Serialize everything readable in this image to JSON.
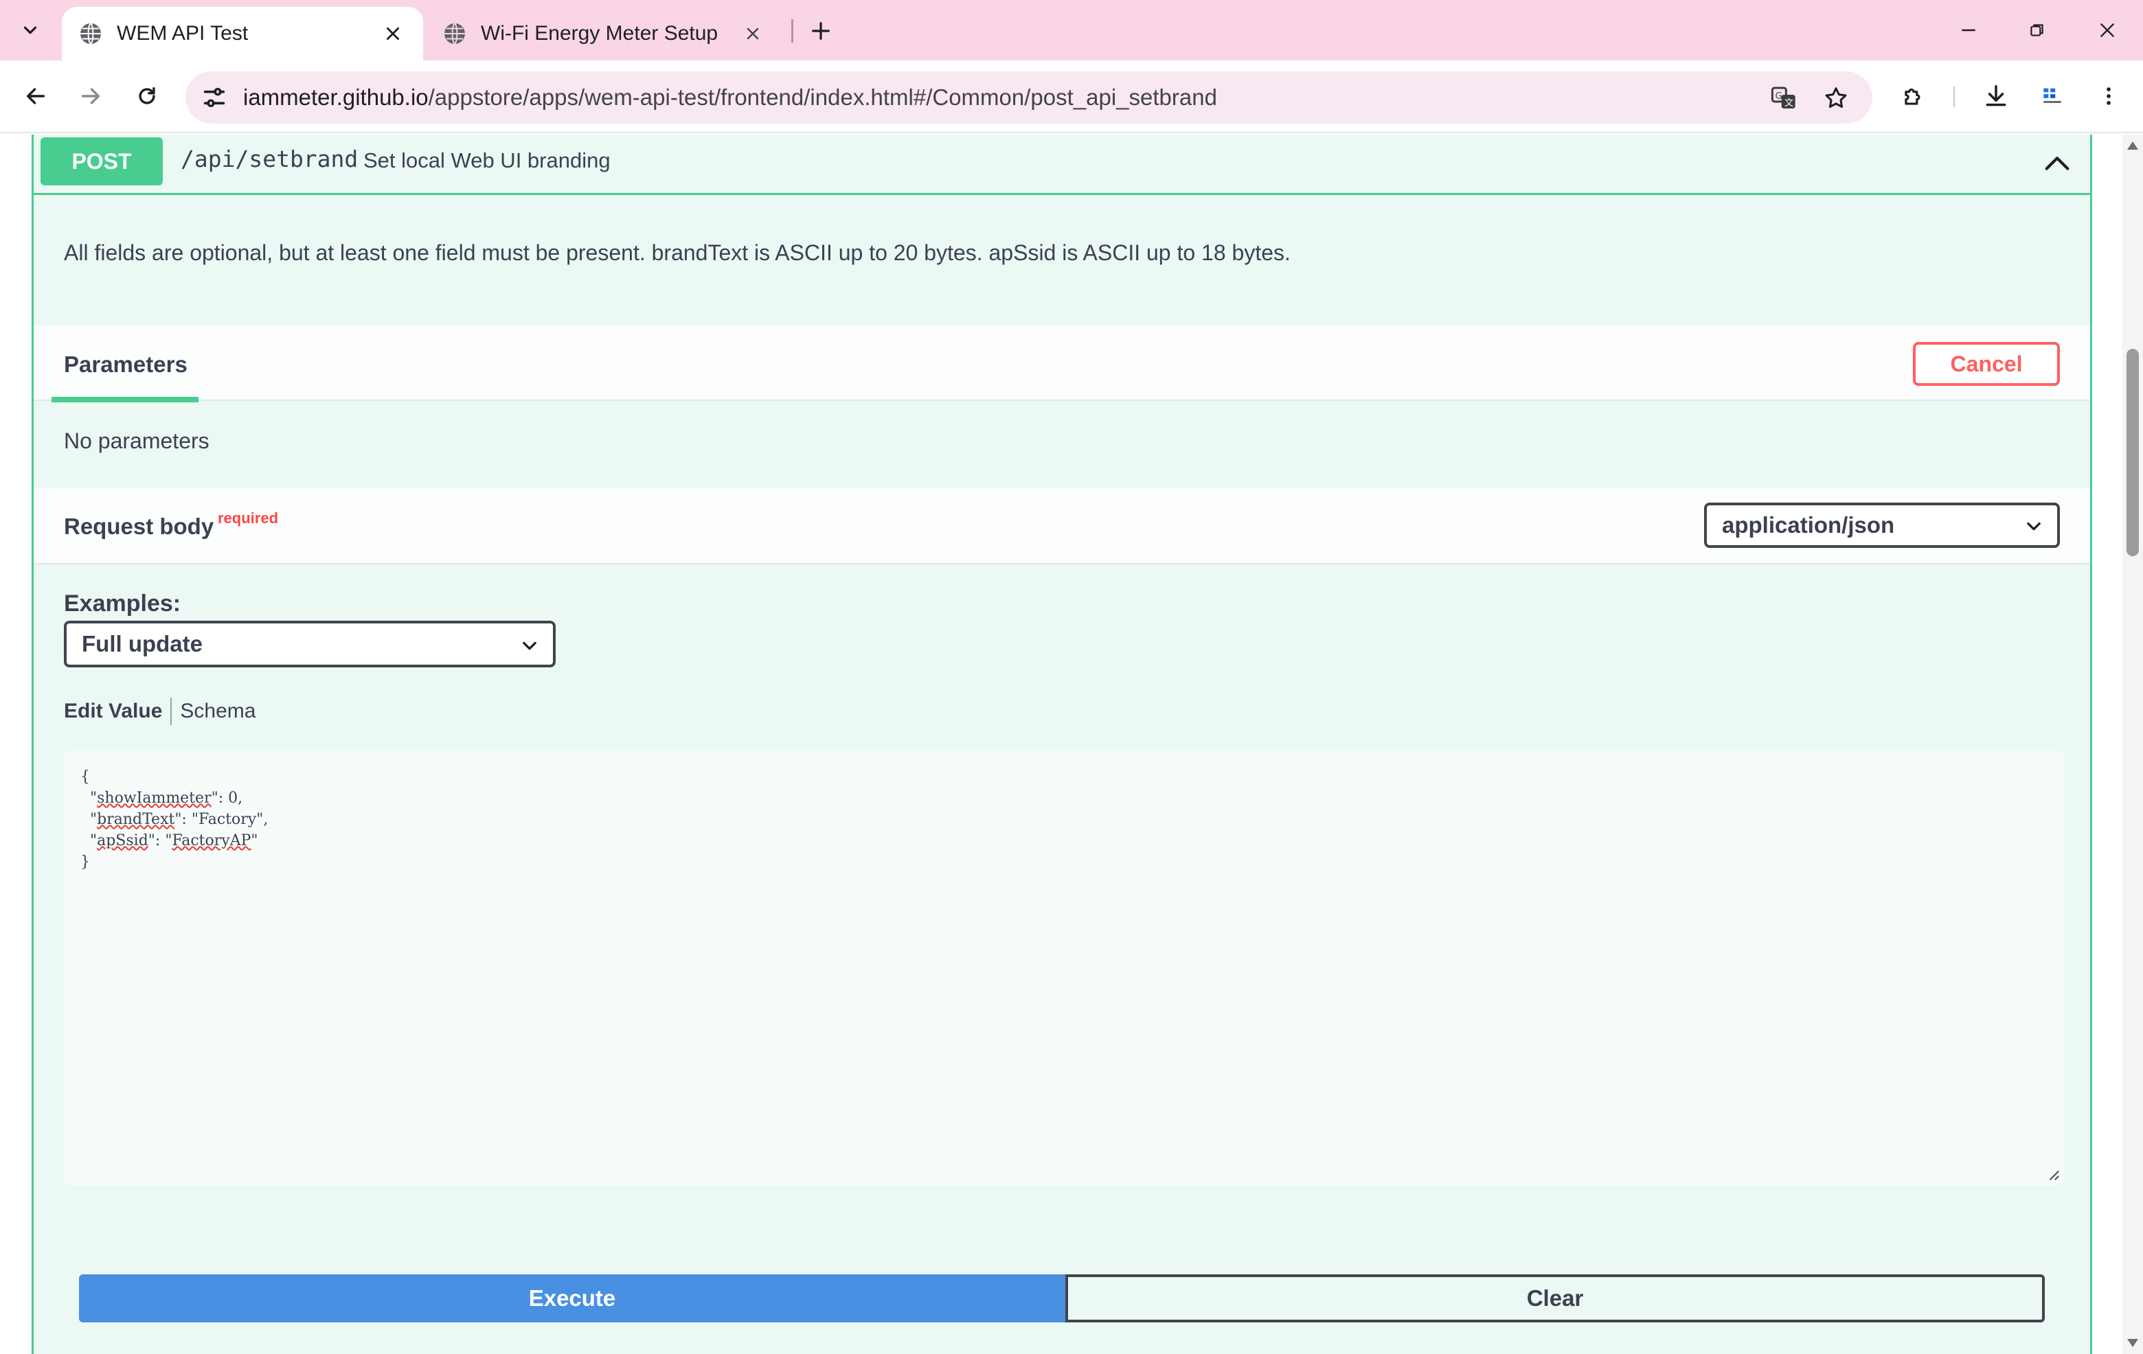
{
  "browser": {
    "tabs": [
      {
        "title": "WEM API Test",
        "active": true
      },
      {
        "title": "Wi-Fi Energy Meter Setup",
        "active": false
      }
    ],
    "url_host": "iammeter.github.io",
    "url_path": "/appstore/apps/wem-api-test/frontend/index.html#/Common/post_api_setbrand",
    "icons": {
      "tab_search": "chevron-down-icon",
      "tab_favicon": "globe-icon",
      "new_tab": "plus-icon",
      "back": "arrow-left-icon",
      "forward": "arrow-right-icon",
      "reload": "reload-icon",
      "site_info": "tune-icon",
      "translate": "translate-icon",
      "bookmark": "star-icon",
      "extensions": "puzzle-icon",
      "downloads": "download-icon",
      "menu": "kebab-icon"
    }
  },
  "operation": {
    "method": "POST",
    "path": "/api/setbrand",
    "summary": "Set local Web UI branding",
    "description": "All fields are optional, but at least one field must be present. brandText is ASCII up to 20 bytes. apSsid is ASCII up to 18 bytes."
  },
  "parameters": {
    "tab_label": "Parameters",
    "cancel_label": "Cancel",
    "empty_text": "No parameters"
  },
  "request_body": {
    "title": "Request body",
    "required_label": "required",
    "content_type": "application/json",
    "examples_label": "Examples:",
    "example_selected": "Full update",
    "edit_value_label": "Edit Value",
    "schema_label": "Schema",
    "body": {
      "open": "{",
      "line1_key": "showIammeter",
      "line1_val": "0",
      "line2_key": "brandText",
      "line2_val": "Factory",
      "line3_key": "apSsid",
      "line3_val": "FactoryAP",
      "close": "}"
    }
  },
  "actions": {
    "execute_label": "Execute",
    "clear_label": "Clear"
  },
  "colors": {
    "post_green": "#49cc90",
    "block_bg": "#ebf8f3",
    "execute_blue": "#4990e2",
    "cancel_red": "#ff6060",
    "tabbar_pink": "#f9d5e6"
  }
}
